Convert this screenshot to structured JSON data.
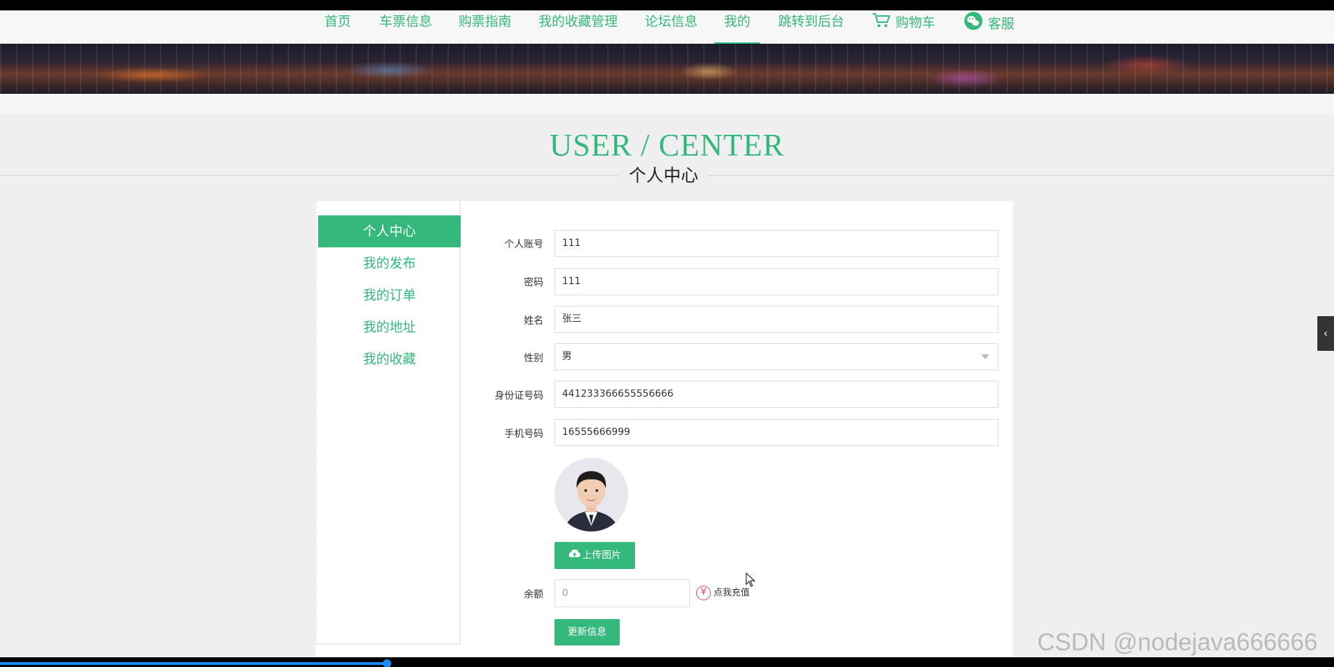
{
  "colors": {
    "accent": "#35b87b",
    "recharge_icon": "#e0465a",
    "progress": "#1a8cff"
  },
  "nav": {
    "items": [
      {
        "label": "首页"
      },
      {
        "label": "车票信息"
      },
      {
        "label": "购票指南"
      },
      {
        "label": "我的收藏管理"
      },
      {
        "label": "论坛信息"
      },
      {
        "label": "我的",
        "active": true
      },
      {
        "label": "跳转到后台"
      },
      {
        "label": "购物车",
        "icon": "cart-icon"
      },
      {
        "label": "客服",
        "icon": "wechat-icon"
      }
    ]
  },
  "header": {
    "title_en": "USER / CENTER",
    "title_cn": "个人中心"
  },
  "sidebar": {
    "items": [
      {
        "label": "个人中心",
        "active": true
      },
      {
        "label": "我的发布"
      },
      {
        "label": "我的订单"
      },
      {
        "label": "我的地址"
      },
      {
        "label": "我的收藏"
      }
    ]
  },
  "form": {
    "account": {
      "label": "个人账号",
      "value": "111"
    },
    "password": {
      "label": "密码",
      "value": "111"
    },
    "name": {
      "label": "姓名",
      "value": "张三"
    },
    "gender": {
      "label": "性别",
      "value": "男"
    },
    "id_number": {
      "label": "身份证号码",
      "value": "441233366655556666"
    },
    "phone": {
      "label": "手机号码",
      "value": "16555666999"
    },
    "upload_button": "上传图片",
    "balance": {
      "label": "余额",
      "value": "0"
    },
    "recharge_link": "点我充值",
    "update_button": "更新信息"
  },
  "recharge_icon": {
    "symbol": "¥"
  },
  "side_toggle": {
    "symbol": "‹"
  },
  "watermark": "CSDN @nodejava666666",
  "video_progress": 0.29
}
